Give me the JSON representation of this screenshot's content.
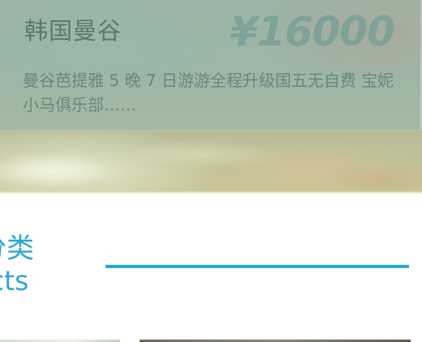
{
  "banner": {
    "title": "韩国曼谷",
    "price": "¥16000",
    "description": "曼谷芭提雅 5 晚 7 日游游全程升级国五无自费 宝妮小马俱乐部……"
  },
  "section": {
    "title_cn": "分类",
    "title_en": "cts"
  },
  "colors": {
    "accent": "#2aa7d8",
    "banner_overlay": "#96b6a8"
  }
}
